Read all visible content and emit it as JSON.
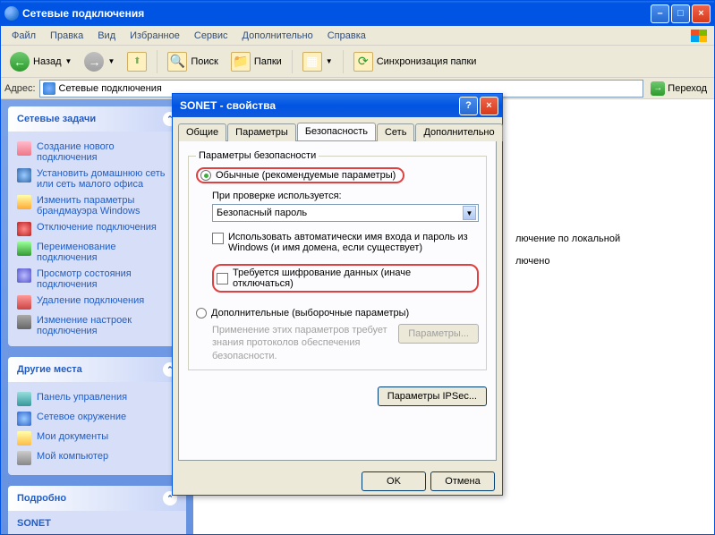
{
  "main_window": {
    "title": "Сетевые подключения",
    "menu": [
      "Файл",
      "Правка",
      "Вид",
      "Избранное",
      "Сервис",
      "Дополнительно",
      "Справка"
    ],
    "toolbar": {
      "back": "Назад",
      "search": "Поиск",
      "folders": "Папки",
      "sync": "Синхронизация папки"
    },
    "address_label": "Адрес:",
    "address_value": "Сетевые подключения",
    "go": "Переход"
  },
  "sidebar": {
    "tasks": {
      "title": "Сетевые задачи",
      "items": [
        "Создание нового подключения",
        "Установить домашнюю сеть или сеть малого офиса",
        "Изменить параметры брандмауэра Windows",
        "Отключение подключения",
        "Переименование подключения",
        "Просмотр состояния подключения",
        "Удаление подключения",
        "Изменение настроек подключения"
      ]
    },
    "places": {
      "title": "Другие места",
      "items": [
        "Панель управления",
        "Сетевое окружение",
        "Мои документы",
        "Мой компьютер"
      ]
    },
    "details": {
      "title": "Подробно",
      "name": "SONET"
    }
  },
  "main_view": {
    "conn_label": "лючение по локальной",
    "conn_status": "лючено"
  },
  "dialog": {
    "title": "SONET - свойства",
    "tabs": [
      "Общие",
      "Параметры",
      "Безопасность",
      "Сеть",
      "Дополнительно"
    ],
    "groupbox_title": "Параметры безопасности",
    "radio1": "Обычные (рекомендуемые параметры)",
    "verify_label": "При проверке используется:",
    "verify_value": "Безопасный пароль",
    "check1": "Использовать автоматически имя входа и пароль из Windows (и имя домена, если существует)",
    "check2": "Требуется шифрование данных (иначе отключаться)",
    "radio2": "Дополнительные (выборочные параметры)",
    "adv_note": "Применение этих параметров требует знания протоколов обеспечения безопасности.",
    "params_btn": "Параметры...",
    "ipsec_btn": "Параметры IPSec...",
    "ok": "OK",
    "cancel": "Отмена"
  }
}
